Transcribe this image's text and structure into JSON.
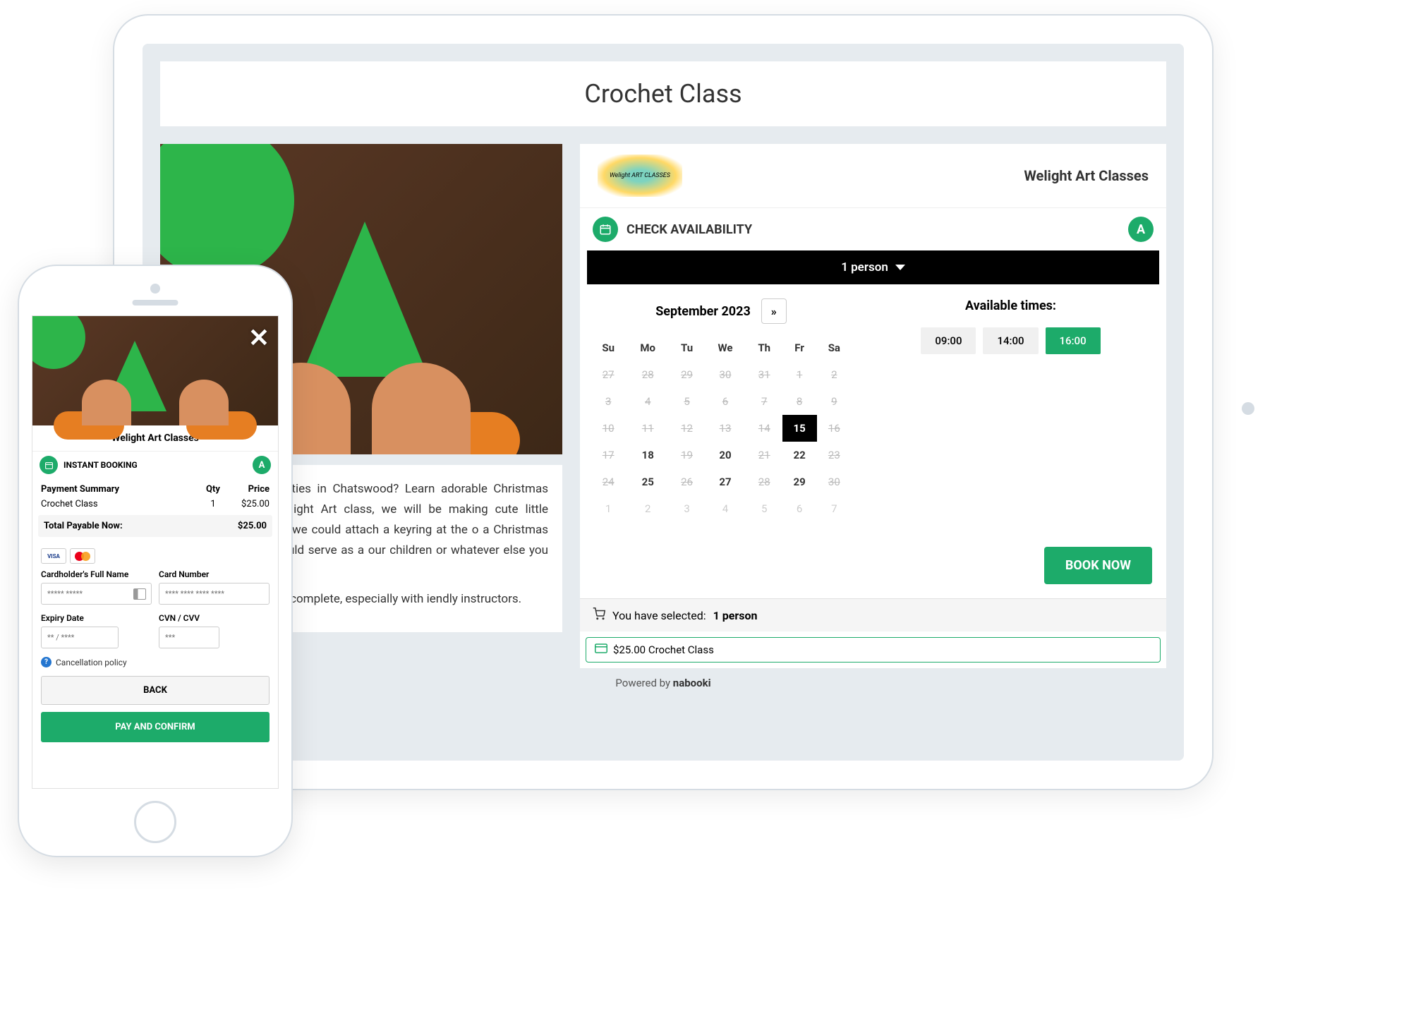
{
  "page": {
    "title": "Crochet Class",
    "description_p1": "xing Christmas activities in Chatswood? Learn adorable Christmas decorations with Welight Art class, we will be making cute little crochet For example, we could attach a keyring at the o a Christmas decoration, it also could serve as a our children or whatever else you can imagine.",
    "description_p2": "ery easy to make and complete, especially with iendly instructors."
  },
  "vendor": {
    "name": "Welight Art Classes",
    "logo_text": "Welight ART CLASSES"
  },
  "availability": {
    "title": "CHECK AVAILABILITY",
    "badge": "A",
    "persons_label": "1 person"
  },
  "calendar": {
    "month_label": "September 2023",
    "next_symbol": "»",
    "weekdays": [
      "Su",
      "Mo",
      "Tu",
      "We",
      "Th",
      "Fr",
      "Sa"
    ],
    "weeks": [
      [
        {
          "d": "27",
          "c": "disabled"
        },
        {
          "d": "28",
          "c": "disabled"
        },
        {
          "d": "29",
          "c": "disabled"
        },
        {
          "d": "30",
          "c": "disabled"
        },
        {
          "d": "31",
          "c": "disabled"
        },
        {
          "d": "1",
          "c": "disabled"
        },
        {
          "d": "2",
          "c": "disabled"
        }
      ],
      [
        {
          "d": "3",
          "c": "disabled"
        },
        {
          "d": "4",
          "c": "disabled"
        },
        {
          "d": "5",
          "c": "disabled"
        },
        {
          "d": "6",
          "c": "disabled"
        },
        {
          "d": "7",
          "c": "disabled"
        },
        {
          "d": "8",
          "c": "disabled"
        },
        {
          "d": "9",
          "c": "disabled"
        }
      ],
      [
        {
          "d": "10",
          "c": "disabled"
        },
        {
          "d": "11",
          "c": "disabled"
        },
        {
          "d": "12",
          "c": "disabled"
        },
        {
          "d": "13",
          "c": "disabled"
        },
        {
          "d": "14",
          "c": "disabled"
        },
        {
          "d": "15",
          "c": "selected"
        },
        {
          "d": "16",
          "c": "disabled"
        }
      ],
      [
        {
          "d": "17",
          "c": "disabled"
        },
        {
          "d": "18",
          "c": "avail"
        },
        {
          "d": "19",
          "c": "disabled"
        },
        {
          "d": "20",
          "c": "avail"
        },
        {
          "d": "21",
          "c": "disabled"
        },
        {
          "d": "22",
          "c": "avail"
        },
        {
          "d": "23",
          "c": "disabled"
        }
      ],
      [
        {
          "d": "24",
          "c": "disabled"
        },
        {
          "d": "25",
          "c": "avail"
        },
        {
          "d": "26",
          "c": "disabled"
        },
        {
          "d": "27",
          "c": "avail"
        },
        {
          "d": "28",
          "c": "disabled"
        },
        {
          "d": "29",
          "c": "avail"
        },
        {
          "d": "30",
          "c": "disabled"
        }
      ],
      [
        {
          "d": "1",
          "c": "other"
        },
        {
          "d": "2",
          "c": "other"
        },
        {
          "d": "3",
          "c": "other"
        },
        {
          "d": "4",
          "c": "other"
        },
        {
          "d": "5",
          "c": "other"
        },
        {
          "d": "6",
          "c": "other"
        },
        {
          "d": "7",
          "c": "other"
        }
      ]
    ]
  },
  "times": {
    "title": "Available times:",
    "slots": [
      {
        "t": "09:00",
        "sel": false
      },
      {
        "t": "14:00",
        "sel": false
      },
      {
        "t": "16:00",
        "sel": true
      }
    ]
  },
  "book_now": "BOOK NOW",
  "selection": {
    "prefix": "You have selected: ",
    "value": "1 person",
    "price_line": "$25.00 Crochet Class"
  },
  "powered": {
    "prefix": "Powered by ",
    "brand": "nabooki"
  },
  "phone": {
    "vendor": "Welight Art Classes",
    "booking_title": "INSTANT BOOKING",
    "badge": "A",
    "summary_label": "Payment Summary",
    "qty_label": "Qty",
    "price_label": "Price",
    "item_name": "Crochet Class",
    "item_qty": "1",
    "item_price": "$25.00",
    "total_label": "Total Payable Now:",
    "total_value": "$25.00",
    "visa": "VISA",
    "name_label": "Cardholder's Full Name",
    "name_ph": "***** *****",
    "card_label": "Card Number",
    "card_ph": "**** **** **** ****",
    "expiry_label": "Expiry Date",
    "expiry_ph": "** / ****",
    "cvv_label": "CVN / CVV",
    "cvv_ph": "***",
    "cancel_policy": "Cancellation policy",
    "info_symbol": "?",
    "back": "BACK",
    "pay": "PAY AND CONFIRM"
  }
}
